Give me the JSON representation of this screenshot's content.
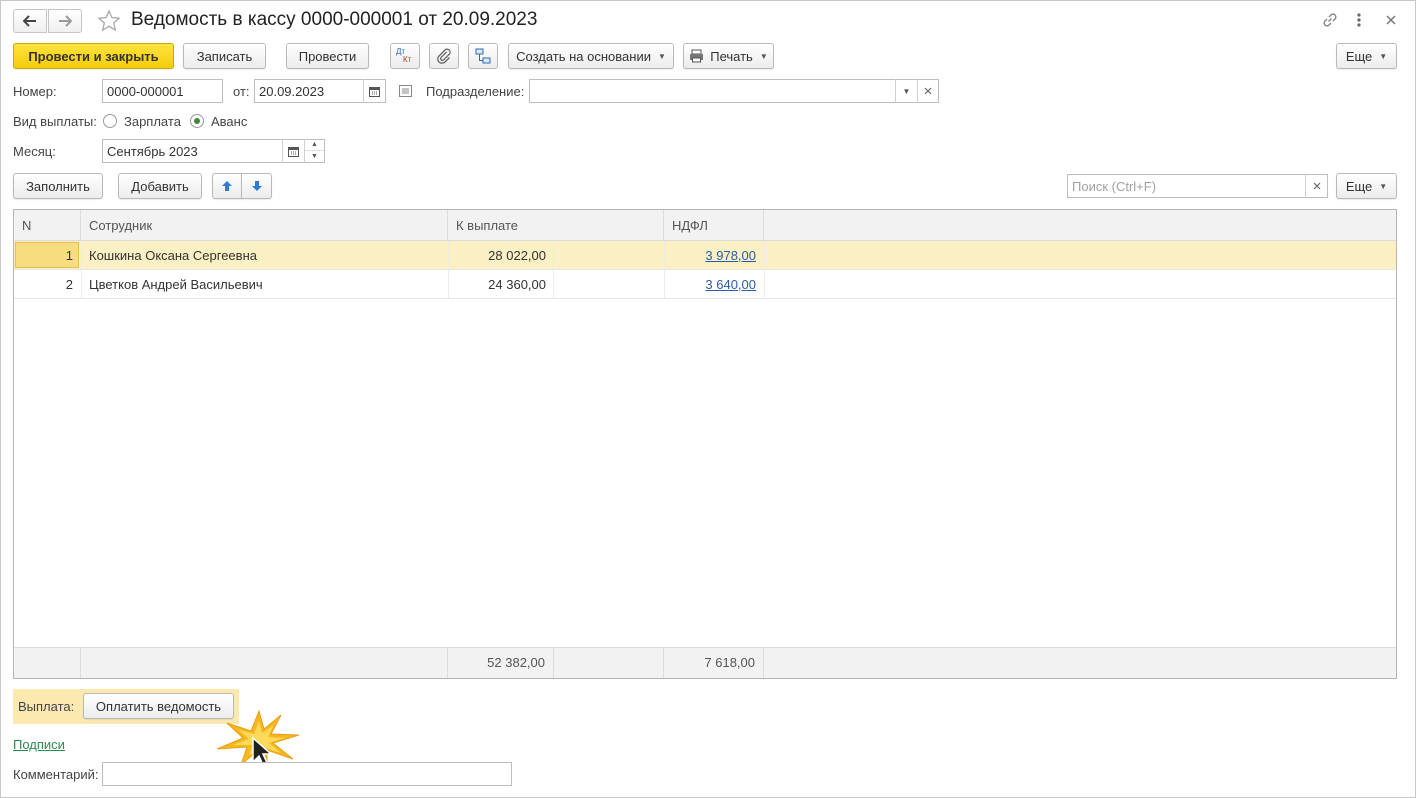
{
  "window": {
    "title": "Ведомость в кассу 0000-000001 от 20.09.2023"
  },
  "toolbar": {
    "post_close_label": "Провести и закрыть",
    "save_label": "Записать",
    "post_label": "Провести",
    "dtkt_label_top": "Дт",
    "dtkt_label_bottom": "Кт",
    "create_based_label": "Создать на основании",
    "print_label": "Печать",
    "more_label": "Еще"
  },
  "form": {
    "number_label": "Номер:",
    "number_value": "0000-000001",
    "date_label": "от:",
    "date_value": "20.09.2023",
    "department_label": "Подразделение:",
    "department_value": "",
    "payment_kind_label": "Вид выплаты:",
    "payment_kind_options": [
      "Зарплата",
      "Аванс"
    ],
    "payment_kind_selected": "Аванс",
    "month_label": "Месяц:",
    "month_value": "Сентябрь 2023"
  },
  "table_toolbar": {
    "fill_label": "Заполнить",
    "add_label": "Добавить",
    "search_placeholder": "Поиск (Ctrl+F)",
    "more_label": "Еще"
  },
  "table": {
    "columns": [
      "N",
      "Сотрудник",
      "К выплате",
      "НДФЛ"
    ],
    "rows": [
      {
        "n": "1",
        "employee": "Кошкина Оксана Сергеевна",
        "to_pay": "28 022,00",
        "ndfl": "3 978,00",
        "selected": true
      },
      {
        "n": "2",
        "employee": "Цветков Андрей Васильевич",
        "to_pay": "24 360,00",
        "ndfl": "3 640,00",
        "selected": false
      }
    ],
    "totals": {
      "to_pay": "52 382,00",
      "ndfl": "7 618,00"
    }
  },
  "footer": {
    "payment_label": "Выплата:",
    "pay_button_label": "Оплатить ведомость",
    "signatures_link": "Подписи",
    "comment_label": "Комментарий:",
    "comment_value": ""
  },
  "colors": {
    "primary_button": "#f4cd0a",
    "selected_row": "#fbf0c3",
    "link": "#2a5cad",
    "signatures_link": "#2d8a4f",
    "payment_panel": "#fbe9b0"
  }
}
